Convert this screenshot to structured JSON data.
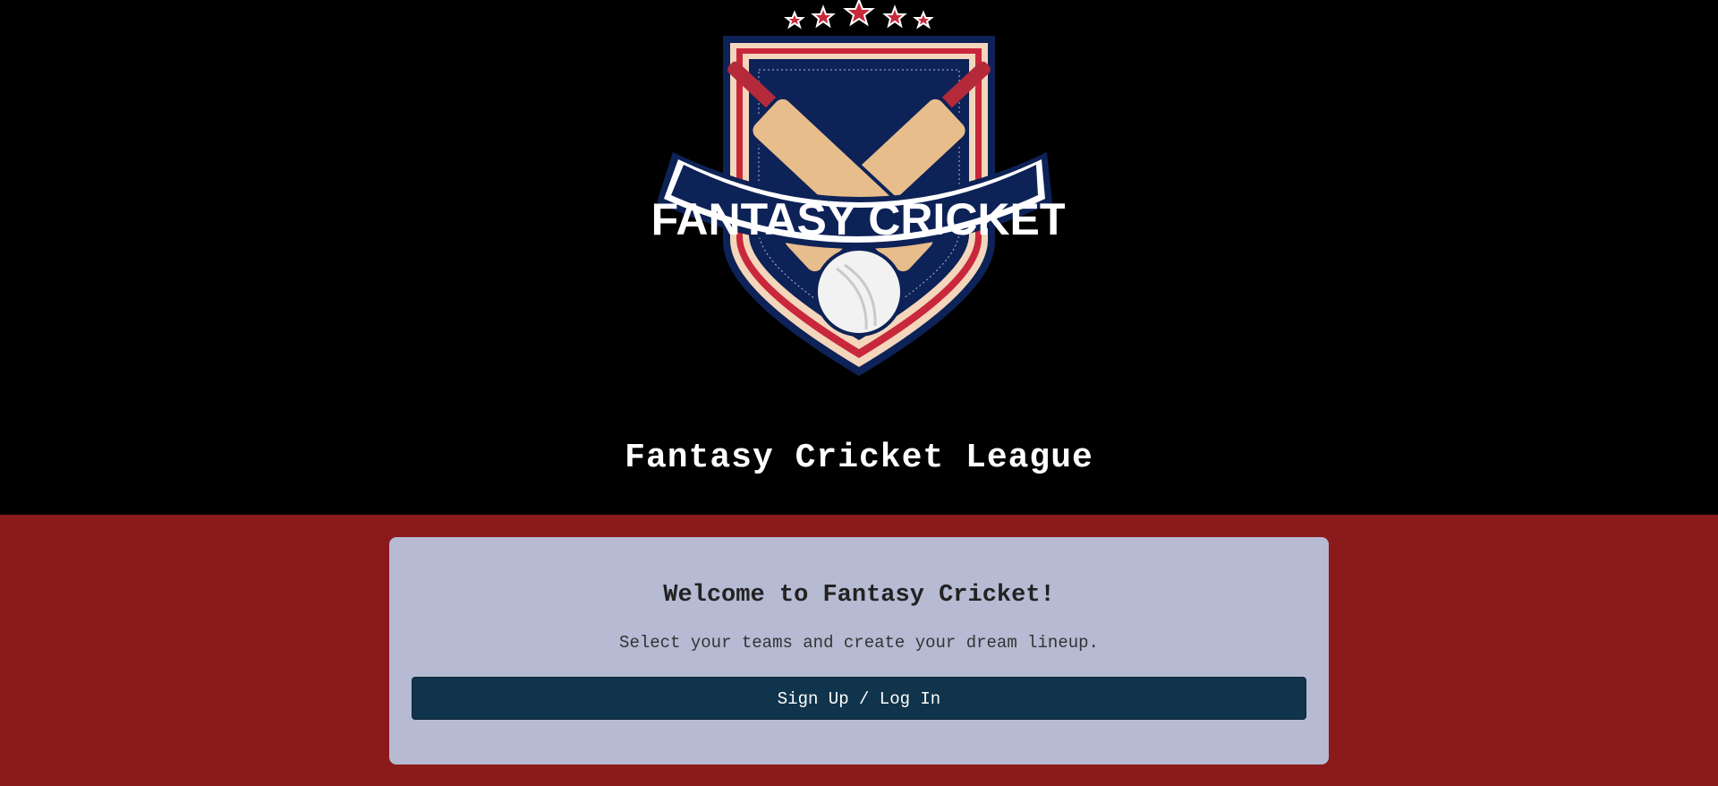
{
  "header": {
    "logo_text": "FANTASY CRICKET",
    "site_title": "Fantasy Cricket League"
  },
  "card": {
    "title": "Welcome to Fantasy Cricket!",
    "subtitle": "Select your teams and create your dream lineup.",
    "button_label": "Sign Up / Log In"
  },
  "colors": {
    "header_bg": "#000000",
    "page_bg": "#8b1a1a",
    "card_bg": "#b6bad2",
    "button_bg": "#10344b",
    "logo_navy": "#0d2257",
    "logo_red": "#c8283a",
    "bat_wood": "#e7bd8c"
  },
  "icons": [
    "star-icon",
    "cricket-bat-icon",
    "cricket-ball-icon",
    "shield-icon"
  ]
}
